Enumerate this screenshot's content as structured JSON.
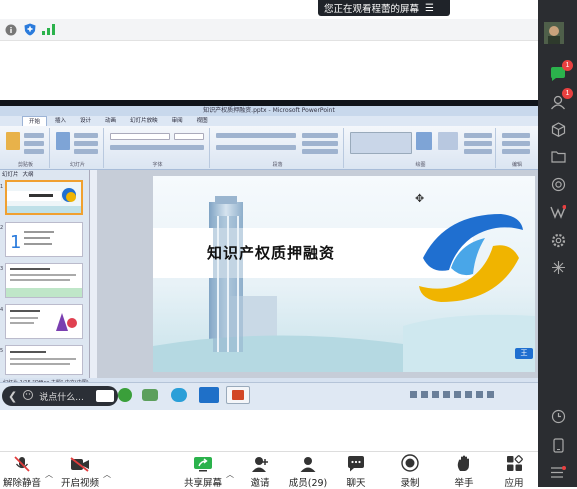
{
  "banner": {
    "text": "您正在观看程蕾的屏幕"
  },
  "ppt": {
    "window_title": "知识产权质押融资.pptx - Microsoft PowerPoint",
    "tabs": [
      "开始",
      "插入",
      "设计",
      "动画",
      "幻灯片放映",
      "审阅",
      "视图"
    ],
    "groups": [
      "剪贴板",
      "幻灯片",
      "字体",
      "段落",
      "绘图",
      "编辑"
    ],
    "panel_tabs": [
      "幻灯片",
      "大纲"
    ],
    "slide_title": "知识产权质押融资",
    "thumb_numbers": [
      "1",
      "2",
      "3",
      "4",
      "5"
    ],
    "status_text": "幻灯片 1/15   \"Office 主题\"   中文(中国)"
  },
  "chat": {
    "placeholder": "说点什么..."
  },
  "sidebar": {
    "chat_badge": "1",
    "contacts_badge": "1"
  },
  "toolbar": {
    "unmute": "解除静音",
    "start_video": "开启视频",
    "share_screen": "共享屏幕",
    "invite": "邀请",
    "members": "成员(29)",
    "chat": "聊天",
    "record": "录制",
    "raise_hand": "举手",
    "apps": "应用"
  },
  "colors": {
    "accent_green": "#2bb24c",
    "dark_sidebar": "#2b2d31",
    "badge_red": "#e84040",
    "logo_blue": "#1f6fd0",
    "logo_gold": "#f0b400"
  }
}
